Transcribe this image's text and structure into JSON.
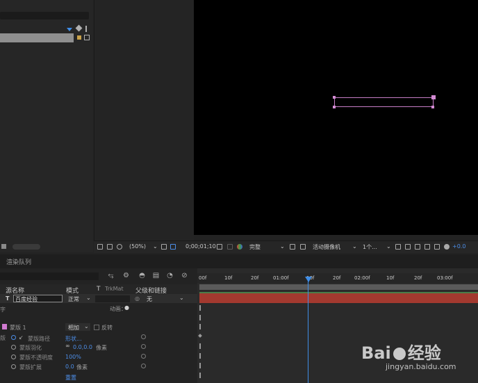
{
  "toolbar": {
    "zoom": "(50%)",
    "timecode": "0;00;01;10",
    "resolution": "完整",
    "camera": "活动摄像机",
    "views": "1个...",
    "exposure": "+0.0"
  },
  "render_queue": {
    "title": "渲染队列"
  },
  "timeline": {
    "columns": {
      "source_name": "源名称",
      "mode": "模式",
      "t": "T",
      "trkmat": "TrkMat",
      "parent": "父级和链接"
    },
    "layer": {
      "type_icon": "T",
      "name": "百度经验",
      "mode": "正常",
      "parent": "无",
      "side_label": "字",
      "animate": "动画："
    },
    "mask": {
      "name": "蒙版 1",
      "mode": "相加",
      "inverted": "反转",
      "side_label": "版"
    },
    "properties": [
      {
        "name": "蒙版路径",
        "value": "形状..."
      },
      {
        "name": "蒙版羽化",
        "value": "0.0,0.0",
        "unit": "像素"
      },
      {
        "name": "蒙版不透明度",
        "value": "100%"
      },
      {
        "name": "蒙版扩展",
        "value": "0.0",
        "unit": "像素"
      }
    ],
    "reset": "重置",
    "ruler_ticks": [
      "00f",
      "10f",
      "20f",
      "01:00f",
      "10f",
      "20f",
      "02:00f",
      "10f",
      "20f",
      "03:00f"
    ]
  },
  "colors": {
    "playhead": "#3f8ee8",
    "layer_bar": "#a3392f",
    "mask_color": "#d07ad0"
  },
  "watermark": {
    "logo_left": "Bai",
    "logo_right": "经验",
    "url": "jingyan.baidu.com"
  }
}
